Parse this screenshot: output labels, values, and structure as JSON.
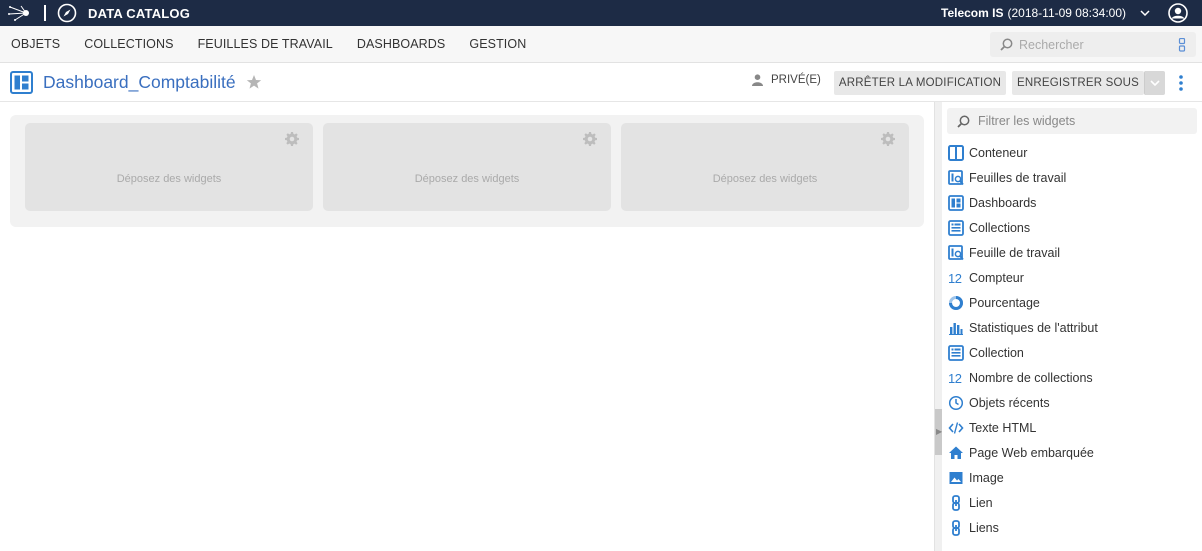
{
  "topbar": {
    "app_title": "DATA CATALOG",
    "tenant": "Telecom IS",
    "tenant_date": "(2018-11-09 08:34:00)"
  },
  "nav": {
    "items": [
      "OBJETS",
      "COLLECTIONS",
      "FEUILLES DE TRAVAIL",
      "DASHBOARDS",
      "GESTION"
    ],
    "search_placeholder": "Rechercher"
  },
  "header": {
    "title": "Dashboard_Comptabilité",
    "privacy": "PRIVÉ(E)",
    "stop_edit_label": "ARRÊTER LA MODIFICATION",
    "save_as_label": "ENREGISTRER SOUS"
  },
  "canvas": {
    "slots": [
      {
        "label": "Déposez des widgets"
      },
      {
        "label": "Déposez des widgets"
      },
      {
        "label": "Déposez des widgets"
      }
    ]
  },
  "panel": {
    "filter_placeholder": "Filtrer les widgets",
    "widgets": [
      {
        "label": "Conteneur",
        "icon": "container-icon"
      },
      {
        "label": "Feuilles de travail",
        "icon": "worksheets-icon"
      },
      {
        "label": "Dashboards",
        "icon": "dashboards-icon"
      },
      {
        "label": "Collections",
        "icon": "collections-icon"
      },
      {
        "label": "Feuille de travail",
        "icon": "worksheet-icon"
      },
      {
        "label": "Compteur",
        "icon": "counter-icon",
        "glyph": "12"
      },
      {
        "label": "Pourcentage",
        "icon": "percentage-icon"
      },
      {
        "label": "Statistiques de l'attribut",
        "icon": "attribute-stats-icon"
      },
      {
        "label": "Collection",
        "icon": "collection-icon"
      },
      {
        "label": "Nombre de collections",
        "icon": "collection-count-icon",
        "glyph": "12"
      },
      {
        "label": "Objets récents",
        "icon": "recent-objects-icon"
      },
      {
        "label": "Texte HTML",
        "icon": "html-code-icon"
      },
      {
        "label": "Page Web embarquée",
        "icon": "embedded-web-page-icon"
      },
      {
        "label": "Image",
        "icon": "image-icon"
      },
      {
        "label": "Lien",
        "icon": "link-icon"
      },
      {
        "label": "Liens",
        "icon": "links-icon"
      }
    ]
  },
  "colors": {
    "topbar": "#1d2b45",
    "accent": "#3a6fbf",
    "icon_blue": "#2f7fcf"
  }
}
